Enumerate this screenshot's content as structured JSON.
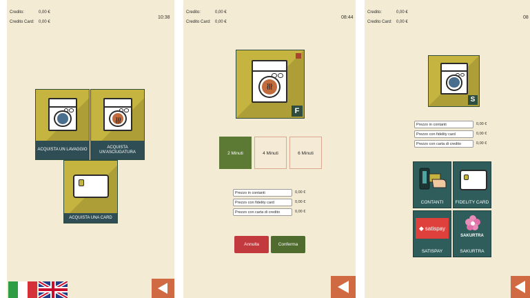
{
  "screens": [
    {
      "credit": {
        "label": "Credito:",
        "value": "0,00 €"
      },
      "credit_card": {
        "label": "Credito Card:",
        "value": "0,00 €"
      },
      "clock": "10:38",
      "tiles": {
        "wash": "ACQUISTA UN LAVAGGIO",
        "dry": "ACQUISTA UN'ASCIUGATURA",
        "card": "ACQUISTA UNA CARD"
      }
    },
    {
      "credit": {
        "label": "Credito:",
        "value": "0,00 €"
      },
      "credit_card": {
        "label": "Credito Card:",
        "value": "0,00 €"
      },
      "clock": "08:44",
      "badge": "F",
      "minutes": [
        "2 Minuti",
        "4 Minuti",
        "6 Minuti"
      ],
      "selected_minutes": "2 Minuti",
      "prices": [
        {
          "label": "Prezzo in contanti",
          "value": "0,00 €"
        },
        {
          "label": "Prezzo con fidelity card",
          "value": "0,00 €"
        },
        {
          "label": "Prezzo con carta di credito",
          "value": "0,00 €"
        }
      ],
      "cancel": "Annulla",
      "confirm": "Conferma"
    },
    {
      "credit": {
        "label": "Credito:",
        "value": "0,00 €"
      },
      "credit_card": {
        "label": "Credito Card:",
        "value": "0,00 €"
      },
      "clock": "08",
      "badge": "S",
      "prices": [
        {
          "label": "Prezzo in contanti",
          "value": "0,00 €"
        },
        {
          "label": "Prezzo con fidelity card",
          "value": "0,00 €"
        },
        {
          "label": "Prezzo con carta di credito",
          "value": "0,00 €"
        }
      ],
      "payments": {
        "cash": "CONTANTI",
        "fidelity": "FIDELITY CARD",
        "satispay": "SATISPAY",
        "satispay_logo": "satispay",
        "sakurtra": "SAKURTRA",
        "sakurtra_logo": "SAKURTRA"
      }
    }
  ],
  "colors": {
    "background": "#f3ebd3",
    "tile": "#c6b440",
    "caption": "#2e4d54",
    "selected": "#5c7a34",
    "cancel": "#c23a3e",
    "confirm": "#4f6b2d",
    "back": "#d06a42",
    "pay_tile": "#2e5d5c",
    "satispay": "#e0403c"
  },
  "icons": [
    "washer-icon",
    "dryer-icon",
    "card-icon",
    "back-arrow-icon",
    "flag-it-icon",
    "flag-uk-icon",
    "cash-hand-icon",
    "flower-icon"
  ]
}
